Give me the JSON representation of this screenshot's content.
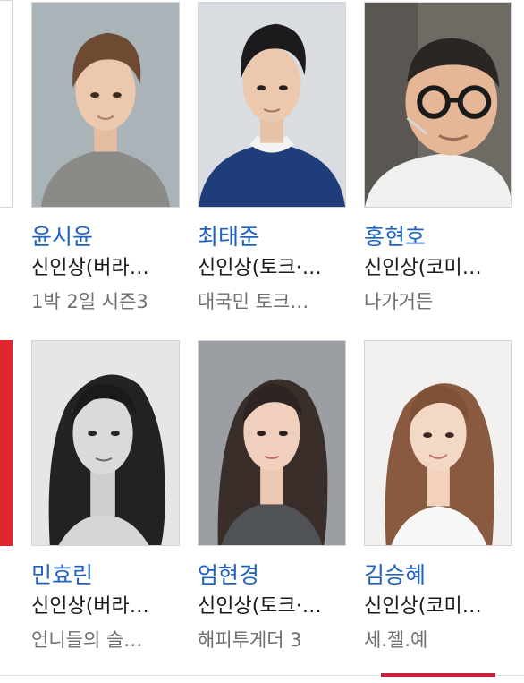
{
  "cards": [
    {
      "name": "윤시윤",
      "award": "신인상(버라…",
      "program": "1박 2일 시즌3",
      "photo_icon": "person-photo-icon"
    },
    {
      "name": "최태준",
      "award": "신인상(토크·…",
      "program": "대국민 토크…",
      "photo_icon": "person-photo-icon"
    },
    {
      "name": "홍현호",
      "award": "신인상(코미…",
      "program": "나가거든",
      "photo_icon": "person-photo-icon"
    },
    {
      "name": "민효린",
      "award": "신인상(버라…",
      "program": "언니들의 슬…",
      "photo_icon": "person-photo-icon"
    },
    {
      "name": "엄현경",
      "award": "신인상(토크·…",
      "program": "해피투게더 3",
      "photo_icon": "person-photo-icon"
    },
    {
      "name": "김승혜",
      "award": "신인상(코미…",
      "program": "세.젤.예",
      "photo_icon": "person-photo-icon"
    }
  ],
  "colors": {
    "name_link": "#1e63c4",
    "award_text": "#1a1a1a",
    "program_text": "#6f6f6f",
    "page_indicator": "#c5223a",
    "prev_card_accent": "#e0252f"
  }
}
